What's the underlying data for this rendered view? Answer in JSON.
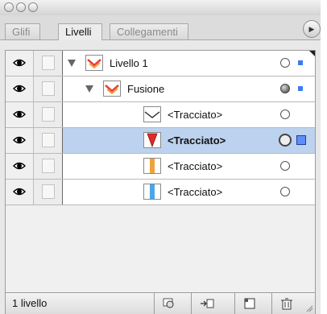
{
  "tabs": [
    {
      "label": "Glifi"
    },
    {
      "label": "Livelli"
    },
    {
      "label": "Collegamenti"
    }
  ],
  "active_tab": "Livelli",
  "layers": [
    {
      "name": "Livello 1",
      "level": 0,
      "expanded": true,
      "thumb": "layer-icon",
      "target": "empty",
      "color": "#3d7bf2",
      "selected": false
    },
    {
      "name": "Fusione",
      "level": 1,
      "expanded": true,
      "thumb": "layer-icon",
      "target": "filled",
      "color": "#3d7bf2",
      "selected": false
    },
    {
      "name": "<Tracciato>",
      "level": 2,
      "thumb": "path-curve-icon",
      "target": "empty",
      "selected": false
    },
    {
      "name": "<Tracciato>",
      "level": 2,
      "thumb": "path-red-triangle-icon",
      "target": "double",
      "color": "#3d7bf2",
      "selected": true
    },
    {
      "name": "<Tracciato>",
      "level": 2,
      "thumb": "path-orange-bar-icon",
      "target": "empty",
      "selected": false
    },
    {
      "name": "<Tracciato>",
      "level": 2,
      "thumb": "path-blue-bar-icon",
      "target": "empty",
      "selected": false
    }
  ],
  "footer": {
    "count_label": "1 livello",
    "buttons": [
      "make-clipping-mask-icon",
      "new-sublayer-icon",
      "new-layer-icon",
      "trash-icon"
    ]
  },
  "colors": {
    "selection": "#bcd2ee",
    "layer_color": "#3d7bf2"
  }
}
